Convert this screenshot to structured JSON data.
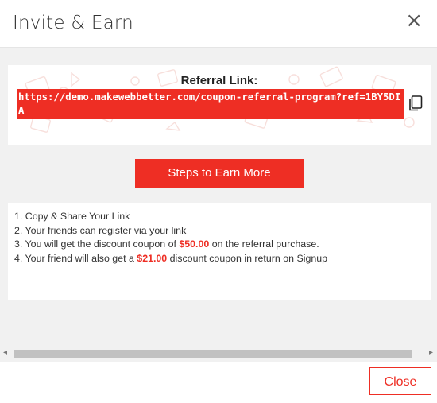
{
  "modal": {
    "title": "Invite & Earn",
    "close_symbol": "×"
  },
  "referral": {
    "heading": "Referral Link:",
    "link": "https://demo.makewebbetter.com/coupon-referral-program?ref=1BY5DIA",
    "copy_icon": "copy-icon"
  },
  "steps_button": {
    "label": "Steps to Earn More"
  },
  "steps": {
    "line1": "1. Copy & Share Your Link",
    "line2": "2. Your friends can register via your link",
    "line3_pre": "3. You will get the discount coupon of ",
    "line3_amount": "$50.00",
    "line3_post": " on the referral purchase.",
    "line4_pre": "4. Your friend will also get a ",
    "line4_amount": "$21.00",
    "line4_post": " discount coupon in return on Signup"
  },
  "scrollbar": {
    "left_arrow": "◂",
    "right_arrow": "▸"
  },
  "footer": {
    "close_label": "Close"
  },
  "colors": {
    "accent": "#ee2e24",
    "body_bg": "#f1f1f1"
  }
}
